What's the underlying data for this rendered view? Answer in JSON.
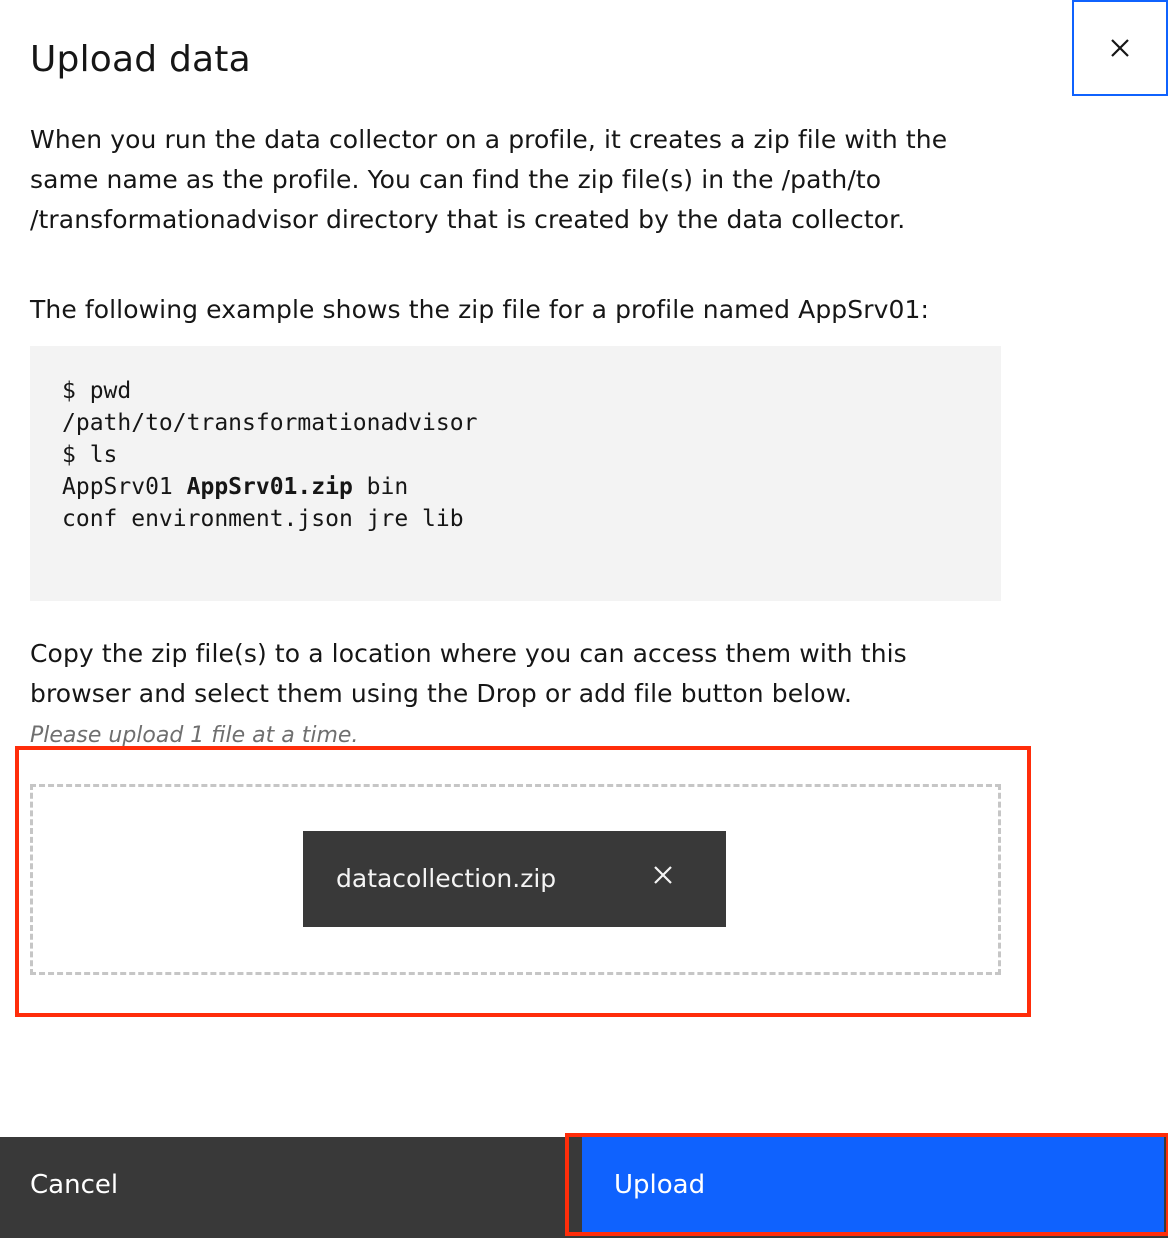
{
  "modal": {
    "title": "Upload data",
    "close_icon": "close-icon",
    "paragraph1": "When you run the data collector on a profile, it creates a zip file with the same name as the profile. You can find the zip file(s) in the /path/to /transformationadvisor directory that is created by the data collector.",
    "paragraph2": "The following example shows the zip file for a profile named AppSrv01:",
    "code": {
      "line1": "$ pwd",
      "line2": "/path/to/transformationadvisor",
      "line3": "$ ls",
      "line4_pre": "AppSrv01 ",
      "line4_bold": "AppSrv01.zip",
      "line4_post": " bin",
      "line5": "conf environment.json jre lib"
    },
    "paragraph3": "Copy the zip file(s) to a location where you can access them with this browser and select them using the Drop or add file button below.",
    "helper_text": "Please upload 1 file at a time.",
    "file": {
      "name": "datacollection.zip",
      "remove_icon": "close-icon"
    },
    "footer": {
      "cancel_label": "Cancel",
      "upload_label": "Upload"
    }
  },
  "colors": {
    "primary": "#0f62fe",
    "highlight": "#ff2d0a",
    "dark": "#393939",
    "code_bg": "#f3f3f3"
  }
}
